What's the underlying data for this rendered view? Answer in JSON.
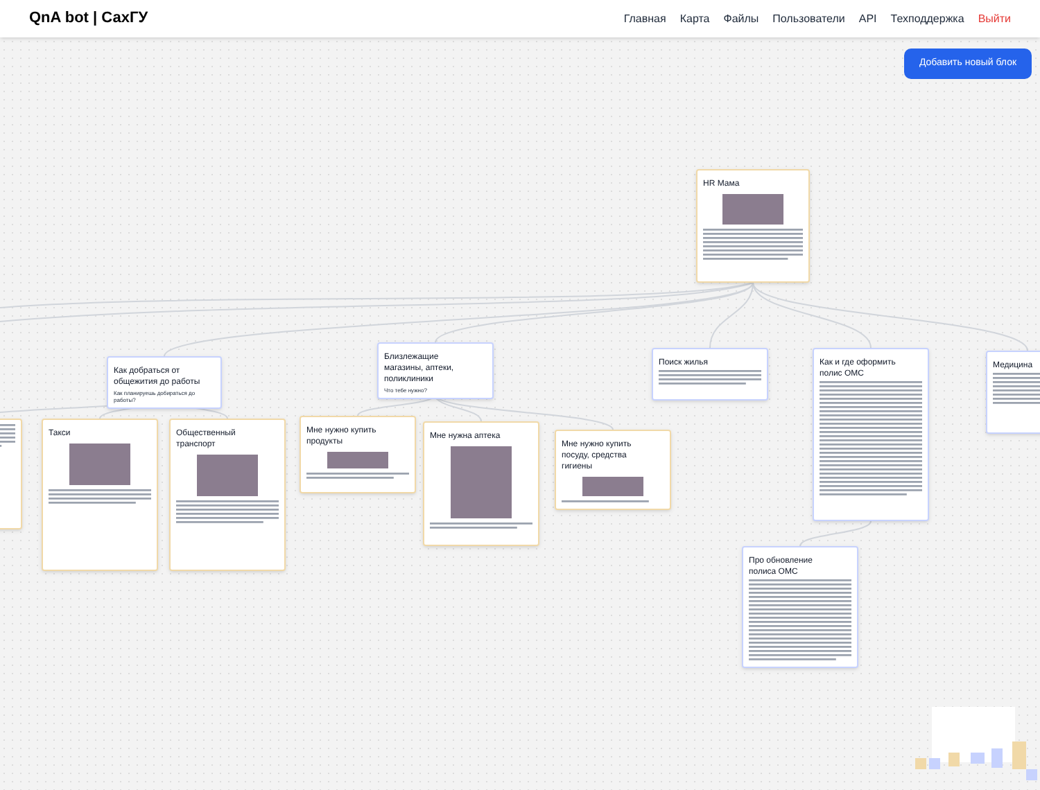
{
  "header": {
    "brand": "QnA bot | СахГУ",
    "nav": [
      {
        "label": "Главная",
        "kind": "link"
      },
      {
        "label": "Карта",
        "kind": "link"
      },
      {
        "label": "Файлы",
        "kind": "link"
      },
      {
        "label": "Пользователи",
        "kind": "link"
      },
      {
        "label": "API",
        "kind": "link"
      },
      {
        "label": "Техподдержка",
        "kind": "link"
      },
      {
        "label": "Выйти",
        "kind": "logout"
      }
    ]
  },
  "add_button": "Добавить новый блок",
  "nodes": [
    {
      "kind": "media",
      "title": "HR Мама"
    },
    {
      "kind": "text",
      "title": "Как добраться от общежития до работы",
      "content": "Как планируешь добираться до работы?"
    },
    {
      "kind": "text",
      "title": "Близлежащие магазины, аптеки, поликлиники",
      "content": "Что тебе нужно?"
    },
    {
      "kind": "text",
      "title": "Поиск жилья"
    },
    {
      "kind": "text",
      "title": "Как и где оформить полис ОМС"
    },
    {
      "kind": "text",
      "title": "Медицина"
    },
    {
      "kind": "media"
    },
    {
      "kind": "media",
      "title": "Такси"
    },
    {
      "kind": "media",
      "title": "Общественный транспорт"
    },
    {
      "kind": "media",
      "title": "Мне нужно купить продукты"
    },
    {
      "kind": "media",
      "title": "Мне нужна аптека"
    },
    {
      "kind": "media",
      "title": "Мне нужно купить посуду, средства гигиены"
    },
    {
      "kind": "text",
      "title": "Про обновление полиса ОМС"
    }
  ]
}
